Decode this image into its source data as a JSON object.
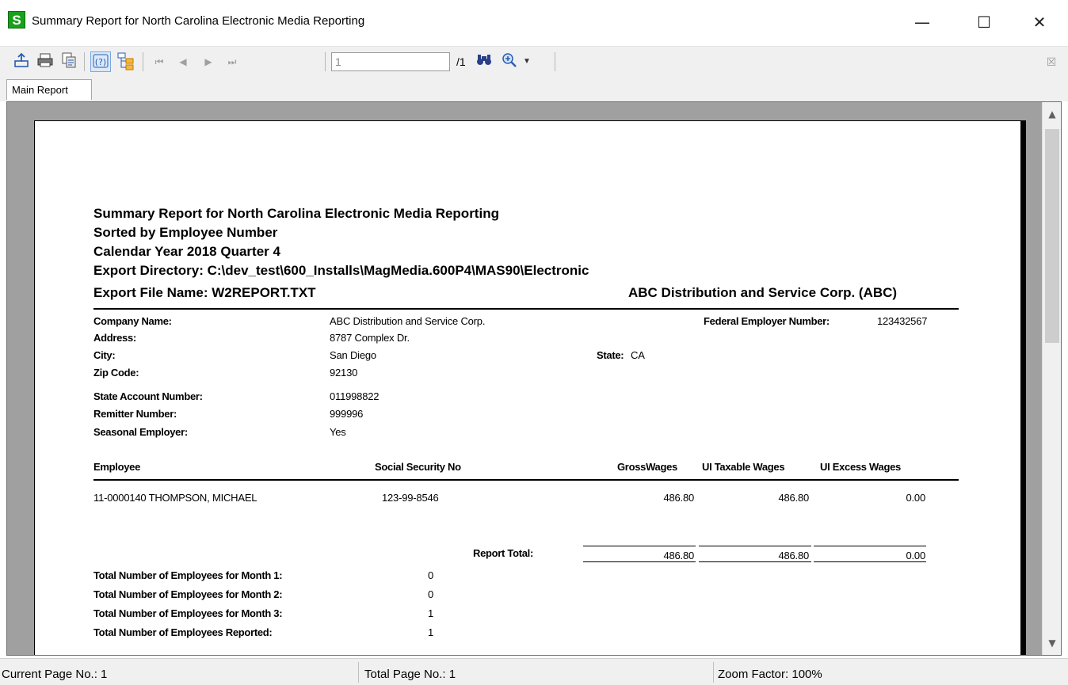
{
  "window": {
    "title": "Summary Report for North Carolina Electronic Media Reporting",
    "app_icon_letter": "S",
    "minimize": "—",
    "maximize": "☐",
    "close": "✕"
  },
  "toolbar": {
    "page_number_value": "1",
    "page_total": "/1",
    "close_panel": "☒",
    "icons": [
      "export-icon",
      "print-icon",
      "copy-icon",
      "help-icon",
      "group-tree-icon",
      "first-page-icon",
      "previous-page-icon",
      "next-page-icon",
      "last-page-icon",
      "find-icon",
      "zoom-icon"
    ]
  },
  "tabs": [
    {
      "label": "Main Report"
    }
  ],
  "report": {
    "title_lines": [
      "Summary Report for North Carolina Electronic Media Reporting",
      "Sorted by Employee Number",
      "Calendar Year 2018 Quarter 4",
      "Export Directory: C:\\dev_test\\600_Installs\\MagMedia.600P4\\MAS90\\Electronic",
      "Export File Name: W2REPORT.TXT"
    ],
    "company_header": "ABC Distribution and Service Corp. (ABC)",
    "company": {
      "name_label": "Company Name:",
      "name_value": "ABC Distribution and Service Corp.",
      "federal_label": "Federal Employer Number:",
      "federal_value": "123432567",
      "address_label": "Address:",
      "address_value": "8787 Complex Dr.",
      "city_label": "City:",
      "city_value": "San Diego",
      "state_label": "State:",
      "state_value": "CA",
      "zip_label": "Zip Code:",
      "zip_value": "92130",
      "state_account_label": "State Account Number:",
      "state_account_value": "011998822",
      "remitter_label": "Remitter Number:",
      "remitter_value": "999996",
      "seasonal_label": "Seasonal Employer:",
      "seasonal_value": "Yes"
    },
    "columns": {
      "employee": "Employee",
      "ssn": "Social Security No",
      "gross": "GrossWages",
      "ui_taxable": "UI Taxable Wages",
      "ui_excess": "UI Excess Wages"
    },
    "rows": [
      {
        "employee": "11-0000140 THOMPSON, MICHAEL",
        "ssn": "123-99-8546",
        "gross": "486.80",
        "ui_taxable": "486.80",
        "ui_excess": "0.00"
      }
    ],
    "totals": {
      "label": "Report Total:",
      "gross": "486.80",
      "ui_taxable": "486.80",
      "ui_excess": "0.00"
    },
    "counts": [
      {
        "label": "Total Number of Employees for Month 1:",
        "value": "0"
      },
      {
        "label": "Total Number of Employees for Month 2:",
        "value": "0"
      },
      {
        "label": "Total Number of Employees for Month 3:",
        "value": "1"
      },
      {
        "label": "Total Number of Employees Reported:",
        "value": "1"
      }
    ]
  },
  "status": {
    "current_page": "Current Page No.: 1",
    "total_page": "Total Page No.: 1",
    "zoom": "Zoom Factor: 100%"
  }
}
